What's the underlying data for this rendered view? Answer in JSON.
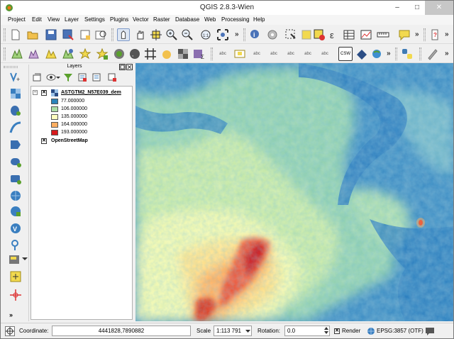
{
  "window": {
    "title": "QGIS 2.8.3-Wien",
    "minimize": "–",
    "maximize": "□",
    "close": "✕"
  },
  "menu": [
    "Project",
    "Edit",
    "View",
    "Layer",
    "Settings",
    "Plugins",
    "Vector",
    "Raster",
    "Database",
    "Web",
    "Processing",
    "Help"
  ],
  "toolbar": {
    "more": "»",
    "csw_label": "CSW",
    "abc_label": "abc"
  },
  "layers_panel": {
    "title": "Layers",
    "layers": [
      {
        "name": "ASTGTM2_N57E039_dem",
        "checked": true,
        "legend": [
          {
            "value": "77.000000",
            "color": "#2b83ba"
          },
          {
            "value": "106.000000",
            "color": "#abdda4"
          },
          {
            "value": "135.000000",
            "color": "#ffffbf"
          },
          {
            "value": "164.000000",
            "color": "#fdae61"
          },
          {
            "value": "193.000000",
            "color": "#d7191c"
          }
        ]
      },
      {
        "name": "OpenStreetMap",
        "checked": true
      }
    ]
  },
  "statusbar": {
    "coordinate_label": "Coordinate:",
    "coordinate_value": "4441828,7890882",
    "scale_label": "Scale",
    "scale_value": "1:113 791",
    "rotation_label": "Rotation:",
    "rotation_value": "0.0",
    "render_label": "Render",
    "render_checked": true,
    "crs_label": "EPSG:3857 (OTF)"
  },
  "colors": {
    "low": "#2b83ba",
    "mid_low": "#abdda4",
    "mid": "#ffffbf",
    "mid_high": "#fdae61",
    "high": "#d7191c"
  }
}
